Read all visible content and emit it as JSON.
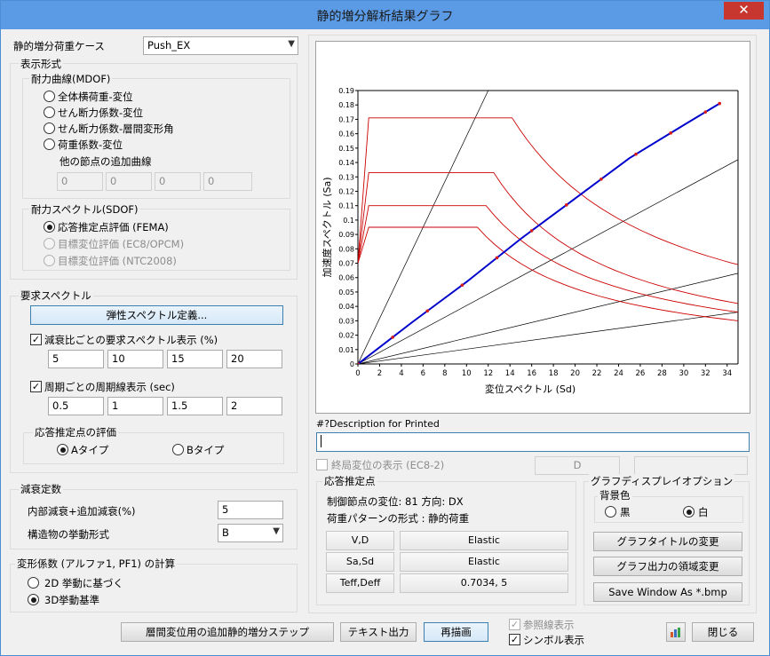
{
  "window": {
    "title": "静的増分解析結果グラフ",
    "close": "✕"
  },
  "load_case": {
    "label": "静的増分荷重ケース",
    "value": "Push_EX"
  },
  "display": {
    "label": "表示形式",
    "mdof": {
      "label": "耐力曲線(MDOF)",
      "options": [
        "全体横荷重-変位",
        "せん断力係数-変位",
        "せん断力係数-層間変形角",
        "荷重係数-変位"
      ],
      "extra_label": "他の節点の追加曲線",
      "extra_values": [
        "0",
        "0",
        "0",
        "0"
      ]
    },
    "sdof": {
      "label": "耐力スペクトル(SDOF)",
      "options": [
        "応答推定点評価 (FEMA)",
        "目標変位評価 (EC8/OPCM)",
        "目標変位評価 (NTC2008)"
      ]
    }
  },
  "demand": {
    "label": "要求スペクトル",
    "define_button": "弾性スペクトル定義...",
    "damping_check": "減衰比ごとの要求スペクトル表示 (%)",
    "damping_values": [
      "5",
      "10",
      "15",
      "20"
    ],
    "period_check": "周期ごとの周期線表示 (sec)",
    "period_values": [
      "0.5",
      "1",
      "1.5",
      "2"
    ],
    "eval": {
      "label": "応答推定点の評価",
      "a": "Aタイプ",
      "b": "Bタイプ"
    }
  },
  "damping": {
    "label": "減衰定数",
    "inner_label": "内部減衰+追加減衰(%)",
    "inner_value": "5",
    "behavior_label": "構造物の挙動形式",
    "behavior_value": "B"
  },
  "coef": {
    "label": "変形係数 (アルファ1, PF1) の計算",
    "opt1": "2D 挙動に基づく",
    "opt2": "3D挙動基準"
  },
  "desc": {
    "label": "#?Description for Printed",
    "value": ""
  },
  "ultimate": {
    "label": "終局変位の表示 (EC8-2)",
    "d_label": "D",
    "d_value": ""
  },
  "perf": {
    "label": "応答推定点",
    "node": "制御節点の変位: 81  方向: DX",
    "pattern": "荷重パターンの形式 : 静的荷重",
    "rows": [
      {
        "k": "V,D",
        "v": "Elastic"
      },
      {
        "k": "Sa,Sd",
        "v": "Elastic"
      },
      {
        "k": "Teff,Deff",
        "v": "0.7034,        5"
      }
    ]
  },
  "graph_opt": {
    "label": "グラフディスプレイオプション",
    "bg_label": "背景色",
    "black": "黒",
    "white": "白",
    "btn_title": "グラフタイトルの変更",
    "btn_region": "グラフ出力の領域変更",
    "btn_save": "Save Window As *.bmp"
  },
  "bottom": {
    "step_btn": "層間変位用の追加静的増分ステップ",
    "text_btn": "テキスト出力",
    "redraw_btn": "再描画",
    "ref_line": "参照線表示",
    "symbol": "シンボル表示",
    "close_btn": "閉じる"
  },
  "colors": {
    "capacity": "#0000cc",
    "demand": "#cc0000",
    "marker": "#d81b1b",
    "period": "#000000"
  },
  "chart_data": {
    "type": "line",
    "xlabel": "変位スペクトル (Sd)",
    "ylabel": "加速度スペクトル (Sa)",
    "xlim": [
      0,
      35
    ],
    "ylim": [
      0,
      0.19
    ],
    "xticks": [
      0,
      2,
      4,
      6,
      8,
      10,
      12,
      14,
      16,
      18,
      20,
      22,
      24,
      26,
      28,
      30,
      32,
      34
    ],
    "yticks": [
      0,
      0.01,
      0.02,
      0.03,
      0.04,
      0.05,
      0.06,
      0.07,
      0.08,
      0.09,
      0.1,
      0.11,
      0.12,
      0.13,
      0.14,
      0.15,
      0.16,
      0.17,
      0.18,
      0.19
    ],
    "capacity": {
      "x": [
        0,
        5,
        10,
        15,
        20,
        25,
        30,
        33.3
      ],
      "y": [
        0,
        0.029,
        0.057,
        0.087,
        0.115,
        0.143,
        0.166,
        0.181
      ]
    },
    "capacity_markers_x": [
      0,
      3.2,
      6.4,
      9.6,
      12.8,
      16,
      19.2,
      22.4,
      25.6,
      28.8,
      32,
      33.3
    ],
    "demand_series": [
      {
        "plateau": 0.171,
        "x1": 1.0,
        "x2": 14.2,
        "end": 0.069
      },
      {
        "plateau": 0.133,
        "x1": 1.0,
        "x2": 12.5,
        "end": 0.042
      },
      {
        "plateau": 0.11,
        "x1": 1.0,
        "x2": 11.8,
        "end": 0.036
      },
      {
        "plateau": 0.095,
        "x1": 1.0,
        "x2": 11.0,
        "end": 0.03
      }
    ],
    "period_lines": [
      {
        "x": [
          0,
          12.0
        ],
        "y": [
          0,
          0.19
        ]
      },
      {
        "x": [
          0,
          35
        ],
        "y": [
          0,
          0.142
        ]
      },
      {
        "x": [
          0,
          35
        ],
        "y": [
          0,
          0.063
        ]
      },
      {
        "x": [
          0,
          35
        ],
        "y": [
          0,
          0.036
        ]
      }
    ]
  }
}
